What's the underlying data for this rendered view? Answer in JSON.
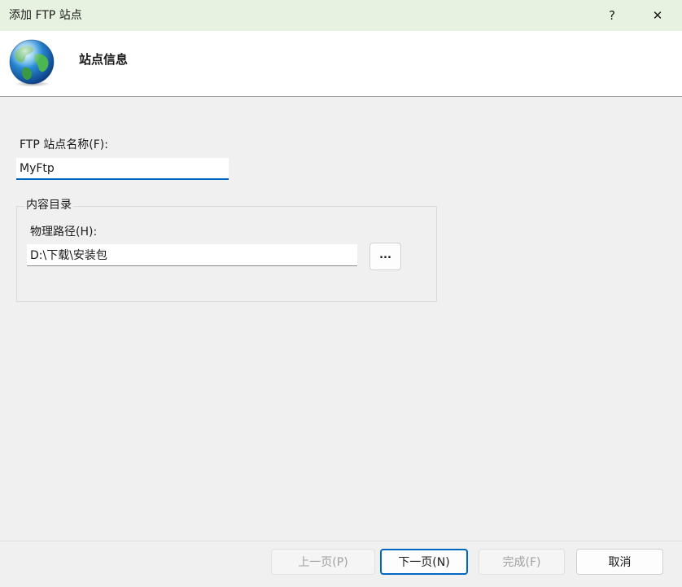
{
  "window": {
    "title": "添加 FTP 站点",
    "help_label": "?",
    "close_label": "✕"
  },
  "header": {
    "heading": "站点信息",
    "icon": "globe-icon"
  },
  "form": {
    "site_name_label": "FTP 站点名称(F):",
    "site_name_value": "MyFtp",
    "content_group_label": "内容目录",
    "physical_path_label": "物理路径(H):",
    "physical_path_value": "D:\\下载\\安装包",
    "browse_label": "..."
  },
  "footer": {
    "prev_label": "上一页(P)",
    "next_label": "下一页(N)",
    "finish_label": "完成(F)",
    "cancel_label": "取消"
  },
  "colors": {
    "titlebar_bg": "#e8f2e1",
    "accent": "#0067c0",
    "background": "#f0f0f0"
  }
}
